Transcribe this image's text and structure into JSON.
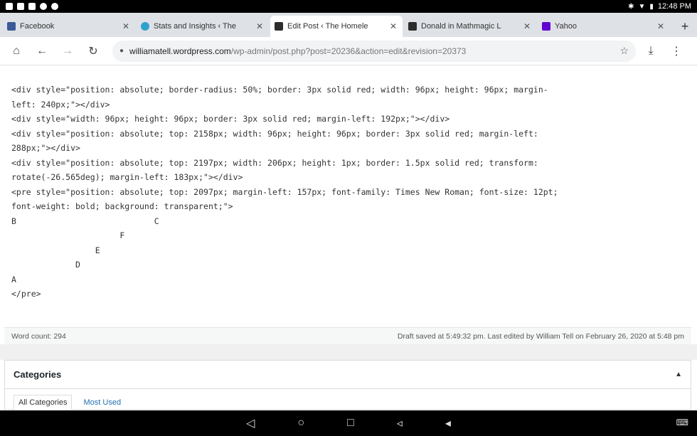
{
  "status_bar": {
    "time": "12:48 PM"
  },
  "tabs": [
    {
      "title": "Facebook",
      "favicon_color": "#3b5998",
      "active": false
    },
    {
      "title": "Stats and Insights ‹ The",
      "favicon_color": "#2ea2cc",
      "active": false
    },
    {
      "title": "Edit Post ‹ The Homele",
      "favicon_color": "#2c2c2c",
      "active": true
    },
    {
      "title": "Donald in Mathmagic L",
      "favicon_color": "#2c2c2c",
      "active": false
    },
    {
      "title": "Yahoo",
      "favicon_color": "#6001d2",
      "active": false
    }
  ],
  "new_tab_label": "+",
  "address": {
    "host": "williamatell.wordpress.com",
    "path": "/wp-admin/post.php?post=20236&action=edit&revision=20373"
  },
  "code_lines": [
    "<div style=\"position: absolute; border-radius: 50%; border: 3px solid red; width: 96px; height: 96px; margin-",
    "left: 240px;\"></div>",
    "<div style=\"width: 96px; height: 96px; border: 3px solid red; margin-left: 192px;\"></div>",
    "<div style=\"position: absolute; top: 2158px; width: 96px; height: 96px; border: 3px solid red; margin-left:",
    "288px;\"></div>",
    "<div style=\"position: absolute; top: 2197px; width: 206px; height: 1px; border: 1.5px solid red; transform:",
    "rotate(-26.565deg); margin-left: 183px;\"></div>",
    "<pre style=\"position: absolute; top: 2097px; margin-left: 157px; font-family: Times New Roman; font-size: 12pt;",
    "font-weight: bold; background: transparent;\">",
    "B                            C",
    "                      F",
    "                 E",
    "             D",
    "A",
    "</pre>"
  ],
  "word_count": "Word count: 294",
  "draft_status": "Draft saved at 5:49:32 pm. Last edited by William Tell on February 26, 2020 at 5:48 pm",
  "categories": {
    "title": "Categories",
    "toggle": "▲",
    "tabs": [
      "All Categories",
      "Most Used"
    ]
  }
}
